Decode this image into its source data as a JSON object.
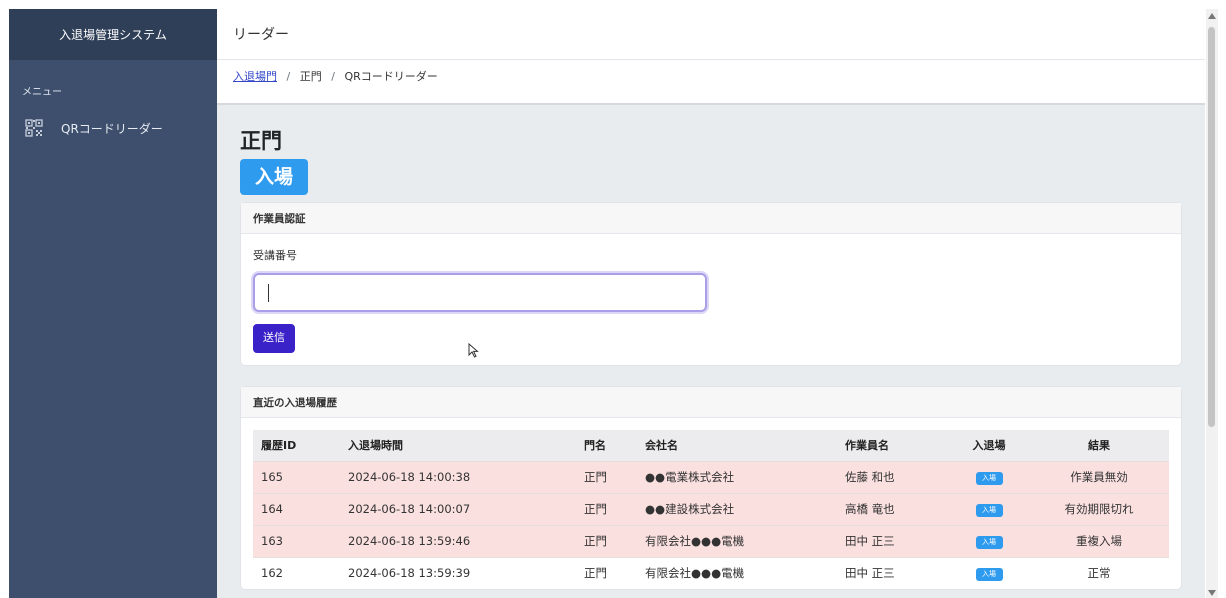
{
  "sidebar": {
    "brand": "入退場管理システム",
    "menu_header": "メニュー",
    "items": [
      {
        "label": "QRコードリーダー",
        "icon": "qr-code-icon"
      }
    ]
  },
  "topbar": {
    "title": "リーダー"
  },
  "breadcrumb": {
    "link": "入退場門",
    "sep1": "/",
    "item2": "正門",
    "sep2": "/",
    "item3": "QRコードリーダー"
  },
  "page": {
    "gate_name": "正門",
    "mode_badge": "入場"
  },
  "auth_card": {
    "header": "作業員認証",
    "field_label": "受講番号",
    "input_value": "",
    "submit_label": "送信"
  },
  "history_card": {
    "header": "直近の入退場履歴",
    "columns": [
      "履歴ID",
      "入退場時間",
      "門名",
      "会社名",
      "作業員名",
      "入退場",
      "結果"
    ],
    "rows": [
      {
        "id": "165",
        "time": "2024-06-18 14:00:38",
        "gate": "正門",
        "company": "●●電業株式会社",
        "worker": "佐藤 和也",
        "io": "入場",
        "result": "作業員無効",
        "status": "error"
      },
      {
        "id": "164",
        "time": "2024-06-18 14:00:07",
        "gate": "正門",
        "company": "●●建設株式会社",
        "worker": "高橋 竜也",
        "io": "入場",
        "result": "有効期限切れ",
        "status": "error"
      },
      {
        "id": "163",
        "time": "2024-06-18 13:59:46",
        "gate": "正門",
        "company": "有限会社●●●電機",
        "worker": "田中 正三",
        "io": "入場",
        "result": "重複入場",
        "status": "error"
      },
      {
        "id": "162",
        "time": "2024-06-18 13:59:39",
        "gate": "正門",
        "company": "有限会社●●●電機",
        "worker": "田中 正三",
        "io": "入場",
        "result": "正常",
        "status": "ok"
      }
    ]
  },
  "colors": {
    "sidebar": "#3d4f6d",
    "brand_bg": "#303f58",
    "accent_badge": "#2f9bef",
    "submit": "#3a22c9",
    "error_row": "#fbe0e0"
  }
}
